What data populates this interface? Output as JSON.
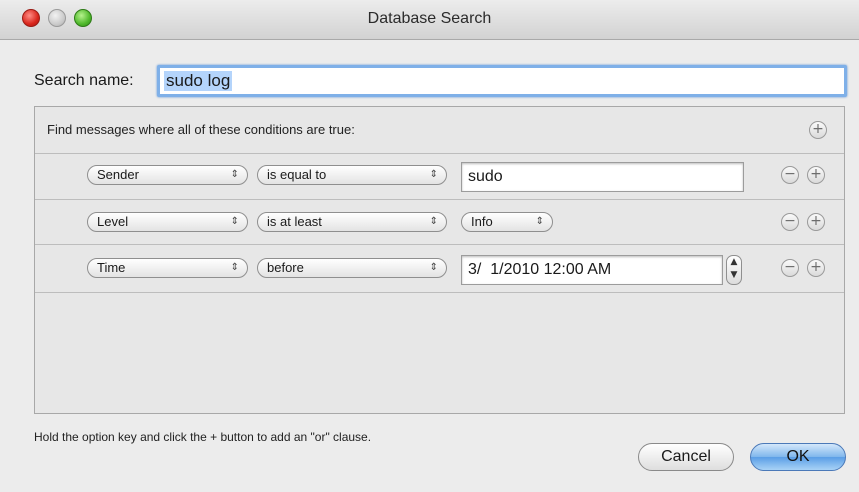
{
  "window": {
    "title": "Database Search"
  },
  "search": {
    "label": "Search name:",
    "value": "sudo log"
  },
  "criteria": {
    "header": "Find messages where all of these conditions are true:",
    "rows": [
      {
        "field": "Sender",
        "operator": "is equal to",
        "value": "sudo"
      },
      {
        "field": "Level",
        "operator": "is at least",
        "value": "Info"
      },
      {
        "field": "Time",
        "operator": "before",
        "value": "3/  1/2010 12:00 AM"
      }
    ]
  },
  "icons": {
    "popup_arrows": "⇕",
    "add": "+",
    "remove": "−",
    "stepper_up": "▲",
    "stepper_down": "▼"
  },
  "hint": "Hold the option key and click the + button to add an \"or\" clause.",
  "buttons": {
    "cancel": "Cancel",
    "ok": "OK"
  },
  "colors": {
    "focus_ring": "#7fb0e8",
    "default_button": "#5b9ee6",
    "close": "#d9261c",
    "zoom": "#4fb82b"
  }
}
